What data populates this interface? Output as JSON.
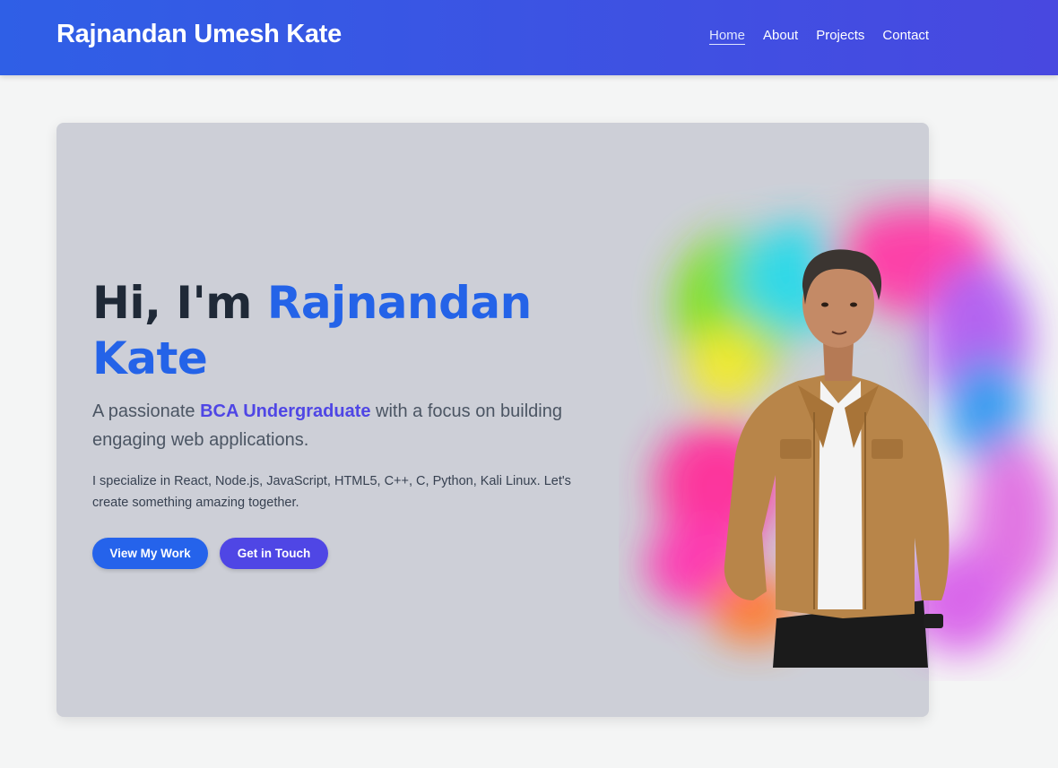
{
  "header": {
    "brand": "Rajnandan Umesh Kate",
    "nav": [
      {
        "label": "Home",
        "active": true
      },
      {
        "label": "About",
        "active": false
      },
      {
        "label": "Projects",
        "active": false
      },
      {
        "label": "Contact",
        "active": false
      }
    ]
  },
  "hero": {
    "greeting": "Hi, I'm ",
    "name_line1": "Rajnandan",
    "name_line2": "Kate",
    "tagline_prefix": "A passionate ",
    "tagline_highlight": "BCA Undergraduate",
    "tagline_suffix": " with a focus on building engaging web applications.",
    "description": "I specialize in React, Node.js, JavaScript, HTML5, C++, C, Python, Kali Linux. Let's create something amazing together.",
    "buttons": {
      "view_work": "View My Work",
      "get_in_touch": "Get in Touch"
    }
  },
  "colors": {
    "nav_gradient_start": "#2f5fe6",
    "nav_gradient_end": "#4848e0",
    "name_accent": "#2463e8",
    "highlight_accent": "#4f46e5",
    "card_bg": "#cdcfd7"
  }
}
